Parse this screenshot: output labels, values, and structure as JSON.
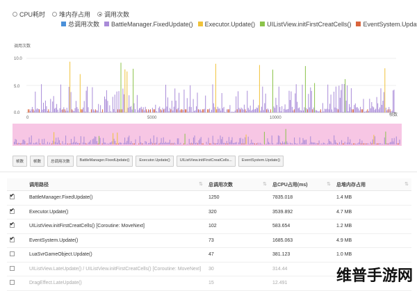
{
  "mode_options": [
    {
      "label": "CPU耗时",
      "checked": false
    },
    {
      "label": "堆内存占用",
      "checked": false
    },
    {
      "label": "调用次数",
      "checked": true
    }
  ],
  "legend": [
    {
      "label": "总调用次数",
      "color": "#4a90d9"
    },
    {
      "label": "BattleManager.FixedUpdate()",
      "color": "#a98bd8"
    },
    {
      "label": "Executor.Update()",
      "color": "#f0c23a"
    },
    {
      "label": "UIListView.initFirstCreatCells()",
      "color": "#8bc34a"
    },
    {
      "label": "EventSystem.Update()",
      "color": "#d9643c"
    }
  ],
  "legend_more_icon": "chevron-down-icon",
  "chart_data": {
    "type": "bar",
    "ylabel": "调用次数",
    "ylim": [
      0,
      10.0
    ],
    "yticks": [
      "10.0",
      "5.0",
      "0.0"
    ],
    "xticks": [
      "0",
      "5000",
      "10000"
    ],
    "xlabel": "帧数",
    "overview_background": "#f7c6e4"
  },
  "tags": [
    "帧数",
    "帧数",
    "总调用次数",
    "BattleManager.FixedUpdate()",
    "Executor.Update()",
    "UIListView.initFirstCreatCells...",
    "EventSystem.Update()"
  ],
  "table": {
    "headers": [
      "调用路径",
      "总调用次数",
      "总CPU占用(ms)",
      "总堆内存占用"
    ],
    "rows": [
      {
        "checked": true,
        "path": "BattleManager.FixedUpdate()",
        "calls": "1250",
        "cpu": "7835.018",
        "mem": "1.4 MB",
        "dim": false
      },
      {
        "checked": true,
        "path": "Executor.Update()",
        "calls": "320",
        "cpu": "3539.892",
        "mem": "4.7 MB",
        "dim": false
      },
      {
        "checked": true,
        "path": "UIListView.initFirstCreatCells() [Coroutine: MoveNext]",
        "calls": "102",
        "cpu": "583.654",
        "mem": "1.2 MB",
        "dim": false
      },
      {
        "checked": true,
        "path": "EventSystem.Update()",
        "calls": "73",
        "cpu": "1685.063",
        "mem": "4.9 MB",
        "dim": false
      },
      {
        "checked": false,
        "path": "LuaSvrGameObject.Update()",
        "calls": "47",
        "cpu": "381.123",
        "mem": "1.0 MB",
        "dim": false
      },
      {
        "checked": false,
        "path": "UIListView.LateUpdate() / UIListView.initFirstCreatCells() [Coroutine: MoveNext]",
        "calls": "30",
        "cpu": "314.44",
        "mem": "",
        "dim": true
      },
      {
        "checked": false,
        "path": "DragEffect.LateUpdate()",
        "calls": "15",
        "cpu": "12.491",
        "mem": "",
        "dim": true
      }
    ]
  },
  "watermark": "维普手游网"
}
